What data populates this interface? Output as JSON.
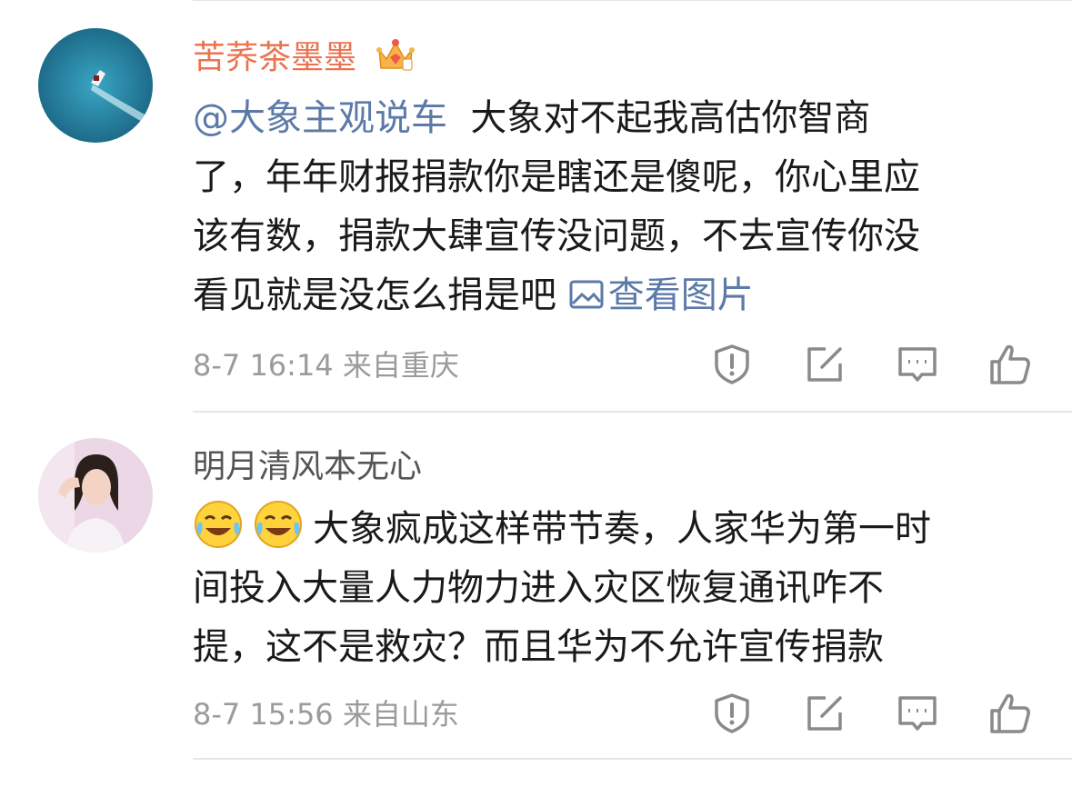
{
  "comments": [
    {
      "username": "苦荞茶墨墨",
      "avatar_desc": "boat-avatar",
      "text_lines": [
        [
          "@大象主观说车",
          "  大象对不起我高估你智商"
        ],
        [
          "了，年年财报捐款你是瞎还是傻呢，你心里应"
        ],
        [
          "该有数，捐款大肆宣传没问题，不去宣传你没"
        ],
        [
          "看见就是没怎么捐是吧 ",
          "查看图片"
        ]
      ],
      "meta": "8-7 16:14  来自重庆"
    },
    {
      "username": "明月清风本无心",
      "text_lines": [
        [
          "大象疯成这样带节奏，人家华为第一时"
        ],
        [
          "间投入大量人力物力进入灾区恢复通讯咋不"
        ],
        [
          "提，这不是救灾？而且华为不允许宣传捐款"
        ]
      ],
      "meta": "8-7 15:56  来自山东"
    }
  ],
  "icons": {
    "report": "report-icon",
    "share": "share-icon",
    "comment": "comment-icon",
    "like": "like-icon",
    "image": "image-icon",
    "crown": "vip-crown-icon",
    "emoji": "laugh-cry-emoji"
  },
  "colors": {
    "vip_name": "#eb7350",
    "link": "#5b7aa8",
    "text": "#1a1a1a",
    "meta": "#9b9b9b"
  }
}
